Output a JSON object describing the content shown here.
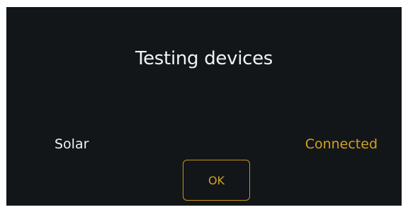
{
  "dialog": {
    "title": "Testing devices",
    "devices": [
      {
        "name": "Solar",
        "status": "Connected"
      }
    ],
    "ok_label": "OK"
  },
  "colors": {
    "background": "#121619",
    "text": "#f2f2f2",
    "accent": "#d3a020"
  }
}
